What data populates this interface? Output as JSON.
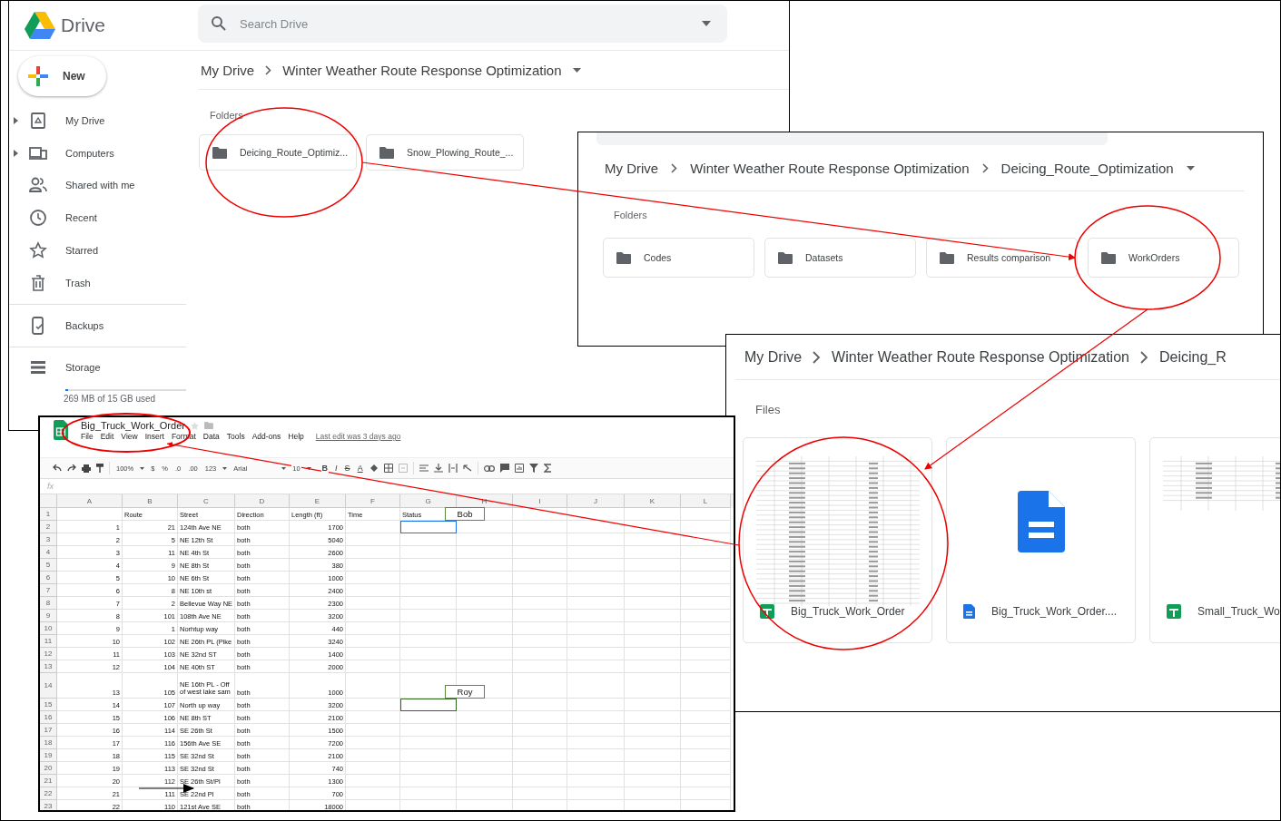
{
  "drive_window": {
    "app_name": "Drive",
    "search": {
      "placeholder": "Search Drive"
    },
    "new_button": "New",
    "nav": [
      {
        "label": "My Drive",
        "kind": "my-drive",
        "expandable": true
      },
      {
        "label": "Computers",
        "kind": "computers",
        "expandable": true
      },
      {
        "label": "Shared with me",
        "kind": "shared",
        "expandable": false
      },
      {
        "label": "Recent",
        "kind": "recent",
        "expandable": false
      },
      {
        "label": "Starred",
        "kind": "starred",
        "expandable": false
      },
      {
        "label": "Trash",
        "kind": "trash",
        "expandable": false
      }
    ],
    "backups": "Backups",
    "storage": {
      "label": "Storage",
      "level": 0.02,
      "usage": "269 MB of 15 GB used"
    },
    "breadcrumb": [
      "My Drive",
      "Winter Weather Route Response Optimization"
    ],
    "section": "Folders",
    "folders": [
      "Deicing_Route_Optimiz...",
      "Snow_Plowing_Route_..."
    ]
  },
  "folder_window": {
    "breadcrumb": [
      "My Drive",
      "Winter Weather Route Response Optimization",
      "Deicing_Route_Optimization"
    ],
    "section": "Folders",
    "folders": [
      "Codes",
      "Datasets",
      "Results comparison",
      "WorkOrders"
    ]
  },
  "files_window": {
    "breadcrumb": [
      "My Drive",
      "Winter Weather Route Response Optimization",
      "Deicing_R"
    ],
    "section": "Files",
    "files": [
      {
        "name": "Big_Truck_Work_Order",
        "kind": "sheet"
      },
      {
        "name": "Big_Truck_Work_Order....",
        "kind": "doc"
      },
      {
        "name": "Small_Truck_Wo",
        "kind": "sheet"
      }
    ]
  },
  "spreadsheet": {
    "title": "Big_Truck_Work_Order",
    "menu": [
      "File",
      "Edit",
      "View",
      "Insert",
      "Format",
      "Data",
      "Tools",
      "Add-ons",
      "Help"
    ],
    "last_edit": "Last edit was 3 days ago",
    "toolbar": [
      {
        "label": "100%",
        "kind": "dropdown"
      },
      {
        "label": "$",
        "kind": "plain"
      },
      {
        "label": "%",
        "kind": "plain"
      },
      {
        "label": ".0",
        "kind": "plain"
      },
      {
        "label": ".00",
        "kind": "plain"
      },
      {
        "label": "123",
        "kind": "dropdown"
      },
      {
        "label": "Arial",
        "kind": "wide"
      },
      {
        "label": "10",
        "kind": "dropdown"
      },
      {
        "label": "B",
        "kind": "bold"
      },
      {
        "label": "I",
        "kind": "italic"
      },
      {
        "label": "S",
        "kind": "strike"
      },
      {
        "label": "A",
        "kind": "underline"
      }
    ],
    "formula_label": "fx",
    "columns": [
      "A",
      "B",
      "C",
      "D",
      "E",
      "F",
      "G",
      "H",
      "I",
      "J",
      "K",
      "L"
    ],
    "header": {
      "row": "1",
      "cells": [
        "Route",
        "Street",
        "Direction",
        "Length (ft)",
        "Time",
        "Status"
      ]
    },
    "rows": [
      {
        "row": "2",
        "cells": [
          "1",
          "21",
          "124th Ave NE",
          "both",
          "1700"
        ],
        "selected": true,
        "note": "Bob"
      },
      {
        "row": "3",
        "cells": [
          "2",
          "5",
          "NE 12th St",
          "both",
          "5040"
        ],
        "selected": false
      },
      {
        "row": "4",
        "cells": [
          "3",
          "11",
          "NE 4th St",
          "both",
          "2600"
        ],
        "selected": false
      },
      {
        "row": "5",
        "cells": [
          "4",
          "9",
          "NE 8th St",
          "both",
          "380"
        ],
        "selected": false
      },
      {
        "row": "6",
        "cells": [
          "5",
          "10",
          "NE 6th St",
          "both",
          "1000"
        ],
        "selected": false
      },
      {
        "row": "7",
        "cells": [
          "6",
          "8",
          "NE 10th st",
          "both",
          "2400"
        ],
        "selected": false
      },
      {
        "row": "8",
        "cells": [
          "7",
          "2",
          "Bellevue Way NE",
          "both",
          "2300"
        ],
        "selected": false
      },
      {
        "row": "9",
        "cells": [
          "8",
          "101",
          "108th Ave NE",
          "both",
          "3200"
        ],
        "selected": false
      },
      {
        "row": "10",
        "cells": [
          "9",
          "1",
          "Norhtup way",
          "both",
          "440"
        ],
        "selected": false
      },
      {
        "row": "11",
        "cells": [
          "10",
          "102",
          "NE 26th PL (Pike",
          "both",
          "3240"
        ],
        "selected": false
      },
      {
        "row": "12",
        "cells": [
          "11",
          "103",
          "NE 32nd ST",
          "both",
          "1400"
        ],
        "selected": false
      },
      {
        "row": "13",
        "cells": [
          "12",
          "104",
          "NE 40th ST",
          "both",
          "2000"
        ],
        "selected": false
      },
      {
        "row": "14",
        "cells": [
          "13",
          "105",
          "NE 16th PL - Off of west lake sam",
          "both",
          "1000"
        ],
        "selected": false,
        "tall": true
      },
      {
        "row": "15",
        "cells": [
          "14",
          "107",
          "North up way",
          "both",
          "3200"
        ],
        "selected": false,
        "note": "Roy"
      },
      {
        "row": "16",
        "cells": [
          "15",
          "106",
          "NE 8th ST",
          "both",
          "2100"
        ],
        "selected": false
      },
      {
        "row": "17",
        "cells": [
          "16",
          "114",
          "SE 26th St",
          "both",
          "1500"
        ],
        "selected": false
      },
      {
        "row": "18",
        "cells": [
          "17",
          "116",
          "156th Ave SE",
          "both",
          "7200"
        ],
        "selected": false
      },
      {
        "row": "19",
        "cells": [
          "18",
          "115",
          "SE 32nd St",
          "both",
          "2100"
        ],
        "selected": false
      },
      {
        "row": "20",
        "cells": [
          "19",
          "113",
          "SE 32nd St",
          "both",
          "740"
        ],
        "selected": false
      },
      {
        "row": "21",
        "cells": [
          "20",
          "112",
          "SE 26th St/Pl",
          "both",
          "1300"
        ],
        "selected": false
      },
      {
        "row": "22",
        "cells": [
          "21",
          "111",
          "SE 22nd Pl",
          "both",
          "700"
        ],
        "selected": false
      },
      {
        "row": "23",
        "cells": [
          "22",
          "110",
          "121st Ave SE",
          "both",
          "18000"
        ],
        "selected": false
      }
    ]
  }
}
